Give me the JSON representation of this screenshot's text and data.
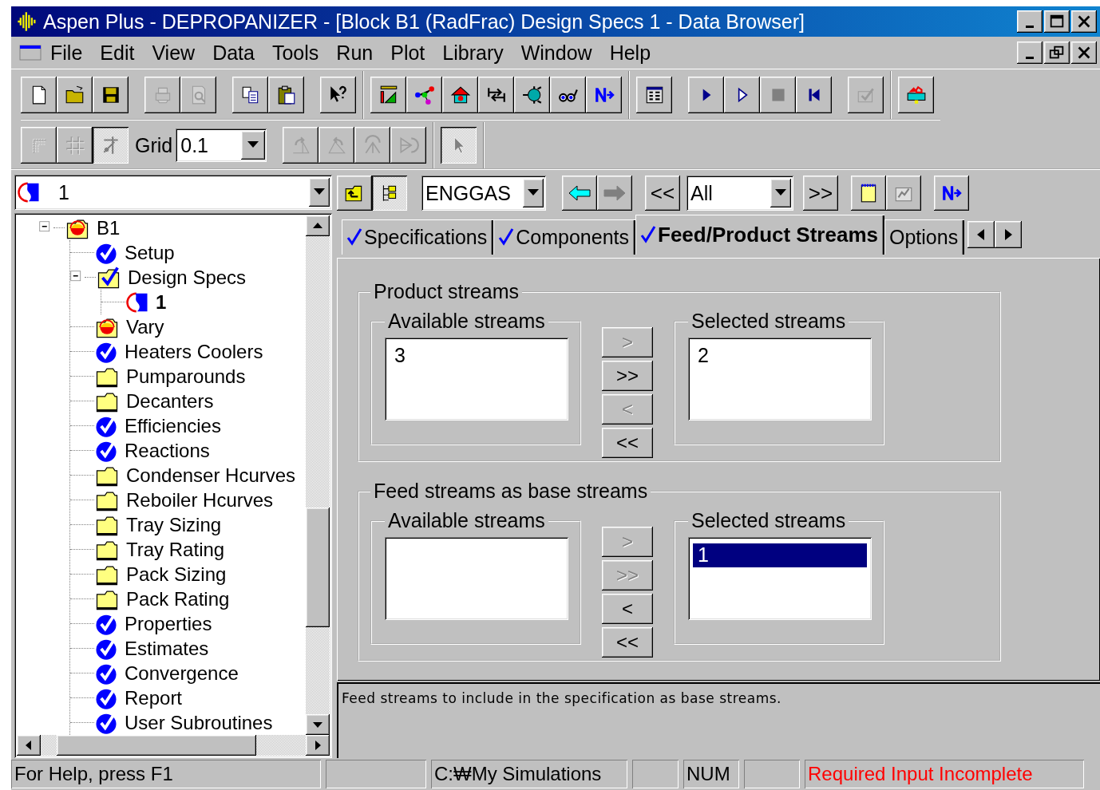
{
  "window": {
    "title": "Aspen Plus - DEPROPANIZER - [Block B1 (RadFrac) Design Specs 1 - Data Browser]"
  },
  "menu": [
    {
      "label": "File"
    },
    {
      "label": "Edit"
    },
    {
      "label": "View"
    },
    {
      "label": "Data"
    },
    {
      "label": "Tools"
    },
    {
      "label": "Run"
    },
    {
      "label": "Plot"
    },
    {
      "label": "Library"
    },
    {
      "label": "Window"
    },
    {
      "label": "Help"
    }
  ],
  "toolbar": {
    "groups": [
      [
        {
          "disabled": false
        },
        {
          "disabled": false
        },
        {
          "disabled": false
        }
      ],
      [
        {
          "disabled": true
        },
        {
          "disabled": true
        }
      ],
      [
        {
          "disabled": false
        },
        {
          "disabled": false
        }
      ],
      [
        {
          "disabled": false
        }
      ],
      [
        {
          "disabled": false
        },
        {
          "disabled": false
        },
        {
          "disabled": false
        },
        {
          "disabled": false
        },
        {
          "disabled": false
        },
        {
          "disabled": false
        },
        {
          "disabled": false
        }
      ],
      [
        {
          "disabled": false
        }
      ],
      [
        {
          "disabled": false
        },
        {
          "disabled": false
        },
        {
          "disabled": false
        },
        {
          "disabled": false
        }
      ],
      [
        {
          "disabled": true
        }
      ],
      [
        {
          "disabled": false
        }
      ]
    ]
  },
  "grid_toolbar": {
    "left_buttons": [
      {
        "disabled": true,
        "on": false
      },
      {
        "disabled": true,
        "on": false
      },
      {
        "disabled": false,
        "on": true
      }
    ],
    "grid": {
      "label": "Grid",
      "value": "0.1"
    },
    "right_buttons": [
      {
        "disabled": true,
        "on": false
      },
      {
        "disabled": true,
        "on": false
      },
      {
        "disabled": true,
        "on": false
      },
      {
        "disabled": true,
        "on": false
      }
    ],
    "pointer": {
      "disabled": false,
      "on": true
    }
  },
  "browser_toolbar": {
    "object_combo": {
      "value": "1"
    },
    "units_combo": {
      "value": "ENGGAS"
    },
    "back_disabled": false,
    "forward_disabled": true,
    "prev": {
      "label": "<<"
    },
    "filter_combo": {
      "value": "All"
    },
    "next": {
      "label": ">>"
    }
  },
  "tree": [
    {
      "label": "B1",
      "kind": "block",
      "expanded": true,
      "children": [
        {
          "label": "Setup",
          "kind": "check"
        },
        {
          "label": "Design Specs",
          "kind": "folder-check",
          "expanded": true,
          "children": [
            {
              "label": "1",
              "kind": "spec",
              "selected": true
            }
          ]
        },
        {
          "label": "Vary",
          "kind": "block"
        },
        {
          "label": "Heaters Coolers",
          "kind": "check"
        },
        {
          "label": "Pumparounds",
          "kind": "folder"
        },
        {
          "label": "Decanters",
          "kind": "folder"
        },
        {
          "label": "Efficiencies",
          "kind": "check"
        },
        {
          "label": "Reactions",
          "kind": "check"
        },
        {
          "label": "Condenser Hcurves",
          "kind": "folder"
        },
        {
          "label": "Reboiler Hcurves",
          "kind": "folder"
        },
        {
          "label": "Tray Sizing",
          "kind": "folder"
        },
        {
          "label": "Tray Rating",
          "kind": "folder"
        },
        {
          "label": "Pack Sizing",
          "kind": "folder"
        },
        {
          "label": "Pack Rating",
          "kind": "folder"
        },
        {
          "label": "Properties",
          "kind": "check"
        },
        {
          "label": "Estimates",
          "kind": "check"
        },
        {
          "label": "Convergence",
          "kind": "check"
        },
        {
          "label": "Report",
          "kind": "check"
        },
        {
          "label": "User Subroutines",
          "kind": "check"
        }
      ]
    }
  ],
  "tabs": [
    {
      "label": "Specifications",
      "checked": true,
      "selected": false
    },
    {
      "label": "Components",
      "checked": true,
      "selected": false
    },
    {
      "label": "Feed/Product Streams",
      "checked": true,
      "selected": true
    },
    {
      "label": "Options",
      "checked": false,
      "selected": false
    }
  ],
  "groups": [
    {
      "title": "Product streams",
      "available": {
        "label": "Available streams",
        "items": [
          {
            "text": "3",
            "selected": false
          }
        ]
      },
      "selected": {
        "label": "Selected streams",
        "items": [
          {
            "text": "2",
            "selected": false
          }
        ]
      },
      "buttons": [
        {
          "label": ">",
          "disabled": true
        },
        {
          "label": ">>",
          "disabled": false
        },
        {
          "label": "<",
          "disabled": true
        },
        {
          "label": "<<",
          "disabled": false
        }
      ]
    },
    {
      "title": "Feed streams as base streams",
      "available": {
        "label": "Available streams"
      },
      "selected": {
        "label": "Selected streams",
        "items": [
          {
            "text": "1",
            "selected": true
          }
        ]
      },
      "buttons": [
        {
          "label": ">",
          "disabled": true
        },
        {
          "label": ">>",
          "disabled": true
        },
        {
          "label": "<",
          "disabled": false
        },
        {
          "label": "<<",
          "disabled": false
        }
      ]
    }
  ],
  "prompt": "Feed streams to include in the specification as base streams.",
  "status_bar": {
    "help": "For Help, press F1",
    "path": "C:₩My Simulations",
    "num": "NUM",
    "status": {
      "text": "Required Input Incomplete",
      "kind": "error"
    }
  }
}
